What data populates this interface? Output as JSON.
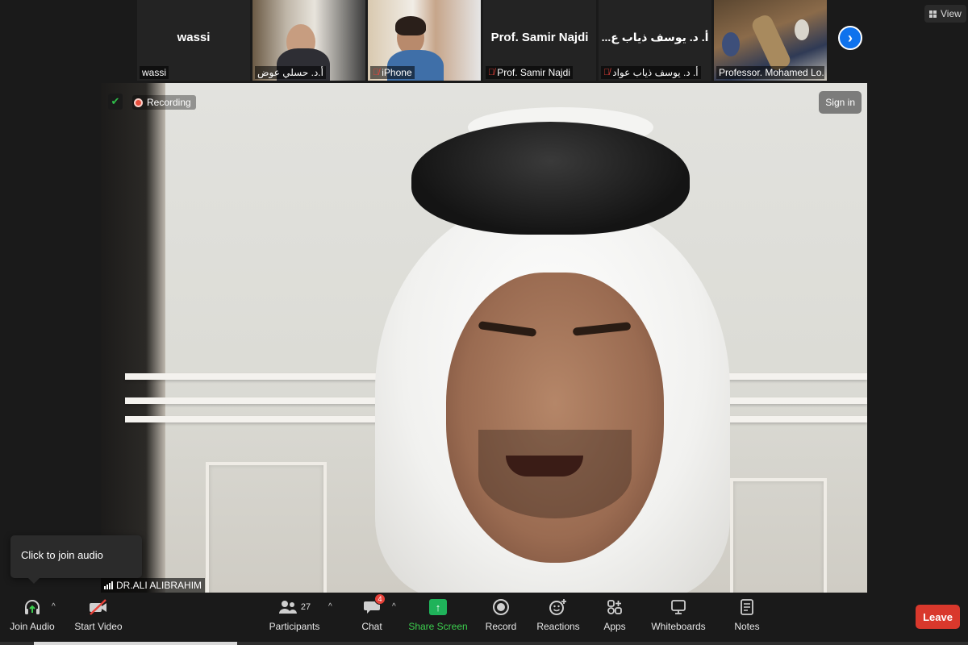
{
  "thumbnails": [
    {
      "display_name": "wassi",
      "caption": "wassi",
      "muted": false,
      "video": false
    },
    {
      "display_name": "",
      "caption": "أ.د. حسلي عوض",
      "muted": false,
      "video": true
    },
    {
      "display_name": "",
      "caption": "iPhone",
      "muted": true,
      "video": true
    },
    {
      "display_name": "Prof. Samir Najdi",
      "caption": "Prof. Samir Najdi",
      "muted": true,
      "video": false
    },
    {
      "display_name": "...أ. د. يوسف ذياب ع",
      "caption": "أ. د. يوسف ذياب عواد",
      "muted": true,
      "video": false
    },
    {
      "display_name": "",
      "caption": "Professor. Mohamed Lo...",
      "muted": false,
      "video": true
    }
  ],
  "view_button": {
    "label": "View"
  },
  "main": {
    "recording_label": "Recording",
    "sign_in_label": "Sign in",
    "speaker_name": "DR.ALI ALIBRAHIM"
  },
  "tooltip": {
    "text": "Click to join audio"
  },
  "toolbar": {
    "join_audio": "Join Audio",
    "start_video": "Start Video",
    "participants": "Participants",
    "participants_count": "27",
    "chat": "Chat",
    "chat_badge": "4",
    "share_screen": "Share Screen",
    "record": "Record",
    "reactions": "Reactions",
    "apps": "Apps",
    "whiteboards": "Whiteboards",
    "notes": "Notes",
    "leave": "Leave"
  },
  "colors": {
    "accent_blue": "#0e72ed",
    "share_green": "#1fb35a",
    "leave_red": "#d9382c",
    "badge_red": "#e8423a"
  }
}
